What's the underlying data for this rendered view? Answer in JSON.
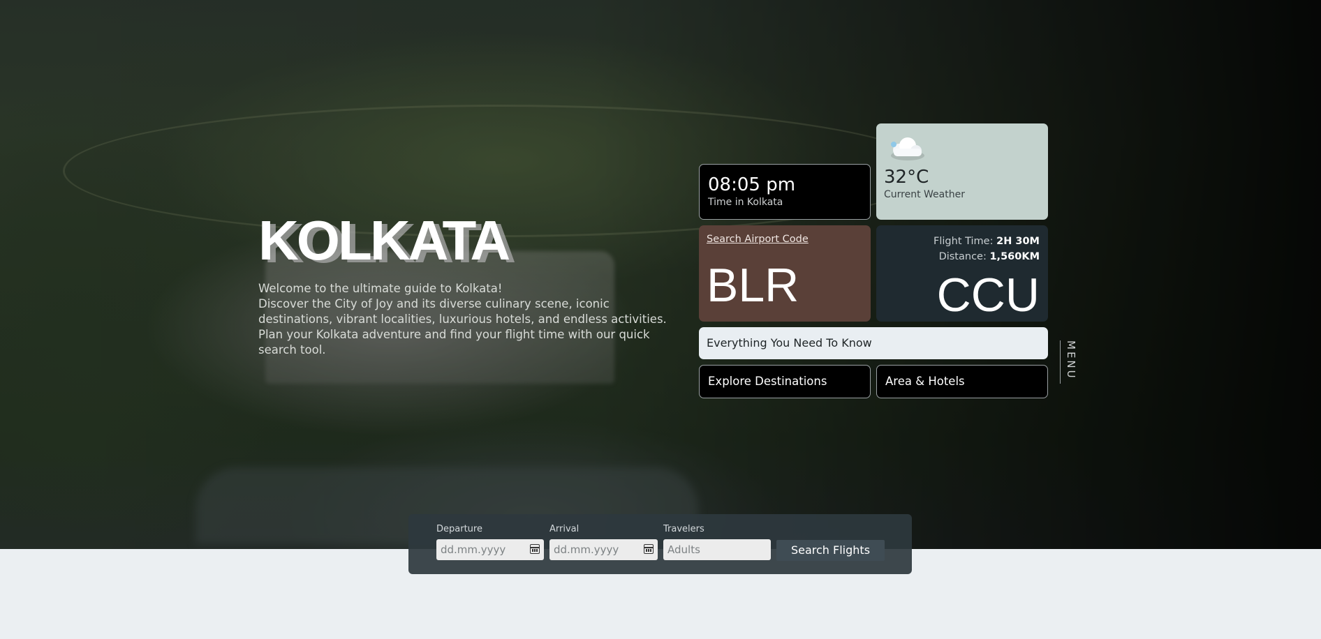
{
  "hero": {
    "title": "KOLKATA",
    "intro_line1": "Welcome to the ultimate guide to Kolkata!",
    "intro_line2": "Discover the City of Joy and its diverse culinary scene, iconic destinations, vibrant localities, luxurious hotels, and endless activities. Plan your Kolkata adventure and find your flight time with our quick search tool."
  },
  "time_card": {
    "time": "08:05 pm",
    "label": "Time in Kolkata"
  },
  "weather_card": {
    "icon": "cloud-icon",
    "temperature": "32°C",
    "label": "Current Weather"
  },
  "from_card": {
    "link": "Search Airport Code",
    "code": "BLR"
  },
  "to_card": {
    "flight_time_label": "Flight Time:",
    "flight_time_value": "2H 30M",
    "distance_label": "Distance:",
    "distance_value": "1,560KM",
    "code": "CCU"
  },
  "links": {
    "everything": "Everything You Need To Know",
    "explore": "Explore Destinations",
    "hotels": "Area & Hotels"
  },
  "menu": {
    "label": "MENU"
  },
  "search": {
    "departure_label": "Departure",
    "departure_placeholder": "dd.mm.yyyy",
    "arrival_label": "Arrival",
    "arrival_placeholder": "dd.mm.yyyy",
    "travelers_label": "Travelers",
    "travelers_placeholder": "Adults",
    "button": "Search Flights"
  },
  "colors": {
    "weather_bg": "#c3d2cd",
    "from_bg": "#5a4038",
    "to_bg": "#1f2a30",
    "page_bg": "#ebeff2"
  }
}
